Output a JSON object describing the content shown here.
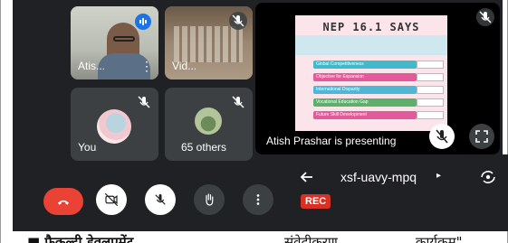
{
  "meeting": {
    "participants": [
      {
        "name": "Atis...",
        "mic_muted": false,
        "speaking": true
      },
      {
        "name": "Vid...",
        "mic_muted": true
      },
      {
        "name": "You",
        "mic_muted": true
      },
      {
        "name": "65 others",
        "mic_muted": true
      }
    ],
    "presentation": {
      "presenter_label": "Atish Prashar is presenting",
      "slide": {
        "title": "NEP 16.1 SAYS",
        "items": [
          {
            "text": "Global Competitiveness",
            "color": "#41b9c9"
          },
          {
            "text": "Objective for Expansion",
            "color": "#e35a9b"
          },
          {
            "text": "International Disparity",
            "color": "#4fb6d6"
          },
          {
            "text": "Vocational Education Gap",
            "color": "#5db06c"
          },
          {
            "text": "Future Skill Development",
            "color": "#e35a9b"
          }
        ]
      }
    },
    "controls": {
      "end_call": "end-call-icon",
      "camera": "camera-off-icon",
      "mic": "mic-off-icon",
      "raise_hand": "hand-icon",
      "more": "more-vertical-icon"
    },
    "meeting_code": "xsf-uavy-mpq",
    "recording_badge": "REC"
  },
  "caption": {
    "part1": "■ फैकल्टी डेवलपमेंट",
    "part2": "संवेदीकरण",
    "part3": "कार्यक्रम\""
  },
  "colors": {
    "end_call": "#ea4335",
    "accent_blue": "#1a73e8",
    "rec": "#d93025",
    "bg": "#202124",
    "tile": "#3c4043"
  }
}
